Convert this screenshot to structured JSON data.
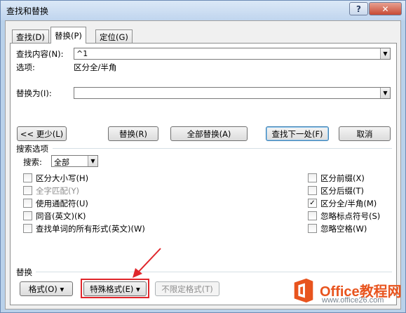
{
  "window": {
    "title": "查找和替换"
  },
  "titlebar": {
    "help": "?",
    "close": "✕"
  },
  "tabs": [
    {
      "label": "查找(D)"
    },
    {
      "label": "替换(P)"
    },
    {
      "label": "定位(G)"
    }
  ],
  "find": {
    "label": "查找内容(N):",
    "value": "^1"
  },
  "options": {
    "label": "选项:",
    "value": "区分全/半角"
  },
  "replace": {
    "label": "替换为(I):",
    "value": ""
  },
  "buttons": {
    "less": "<< 更少(L)",
    "replace": "替换(R)",
    "replace_all": "全部替换(A)",
    "find_next": "查找下一处(F)",
    "cancel": "取消"
  },
  "search_options": {
    "title": "搜索选项",
    "search_label": "搜索:",
    "search_value": "全部"
  },
  "checkboxes_left": [
    {
      "label": "区分大小写(H)",
      "checked": false,
      "disabled": false
    },
    {
      "label": "全字匹配(Y)",
      "checked": false,
      "disabled": true
    },
    {
      "label": "使用通配符(U)",
      "checked": false,
      "disabled": false
    },
    {
      "label": "同音(英文)(K)",
      "checked": false,
      "disabled": false
    },
    {
      "label": "查找单词的所有形式(英文)(W)",
      "checked": false,
      "disabled": false
    }
  ],
  "checkboxes_right": [
    {
      "label": "区分前缀(X)",
      "checked": false
    },
    {
      "label": "区分后缀(T)",
      "checked": false
    },
    {
      "label": "区分全/半角(M)",
      "checked": true
    },
    {
      "label": "忽略标点符号(S)",
      "checked": false
    },
    {
      "label": "忽略空格(W)",
      "checked": false
    }
  ],
  "replace_section": {
    "title": "替换",
    "format": "格式(O) ▾",
    "special": "特殊格式(E) ▾",
    "no_format": "不限定格式(T)"
  },
  "watermark": {
    "brand_a": "Office",
    "brand_b": "教程网",
    "url": "www.office26.com"
  },
  "colors": {
    "highlight_red": "#e0262b",
    "brand_orange": "#e8541e"
  }
}
